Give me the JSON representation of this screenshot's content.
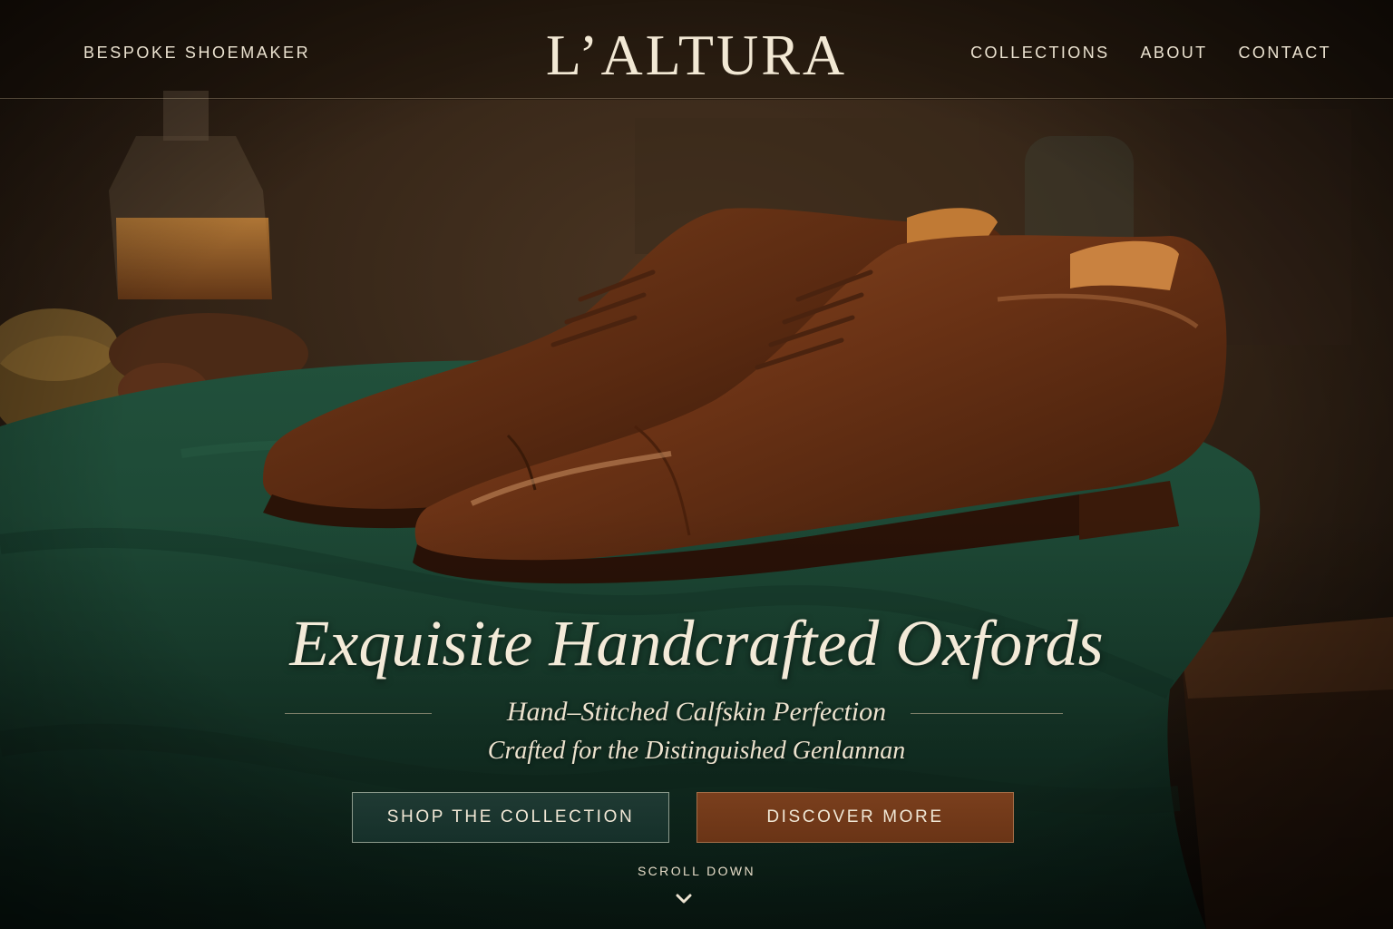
{
  "header": {
    "tagline": "BESPOKE SHOEMAKER",
    "logo": "L’ALTURA",
    "nav": [
      {
        "label": "COLLECTIONS"
      },
      {
        "label": "ABOUT"
      },
      {
        "label": "CONTACT"
      }
    ]
  },
  "hero": {
    "headline": "Exquisite Handcrafted Oxfords",
    "subtitle": "Hand–Stitched Calfskin Perfection",
    "subtitle_secondary": "Crafted for the Distinguished Genlannan",
    "image_subject": "pair of brown cap-toe oxford shoes on green velvet",
    "buttons": {
      "primary": "SHOP THE COLLECTION",
      "secondary": "DISCOVER MORE"
    },
    "scroll_label": "SCROLL DOWN",
    "scroll_icon": "chevron-down-icon"
  },
  "colors": {
    "text_cream": "#efe6d4",
    "button_green": "#1f3a33",
    "button_brown": "#7a3f1d",
    "velvet_green": "#1e4a35",
    "leather_brown": "#6b3417"
  }
}
